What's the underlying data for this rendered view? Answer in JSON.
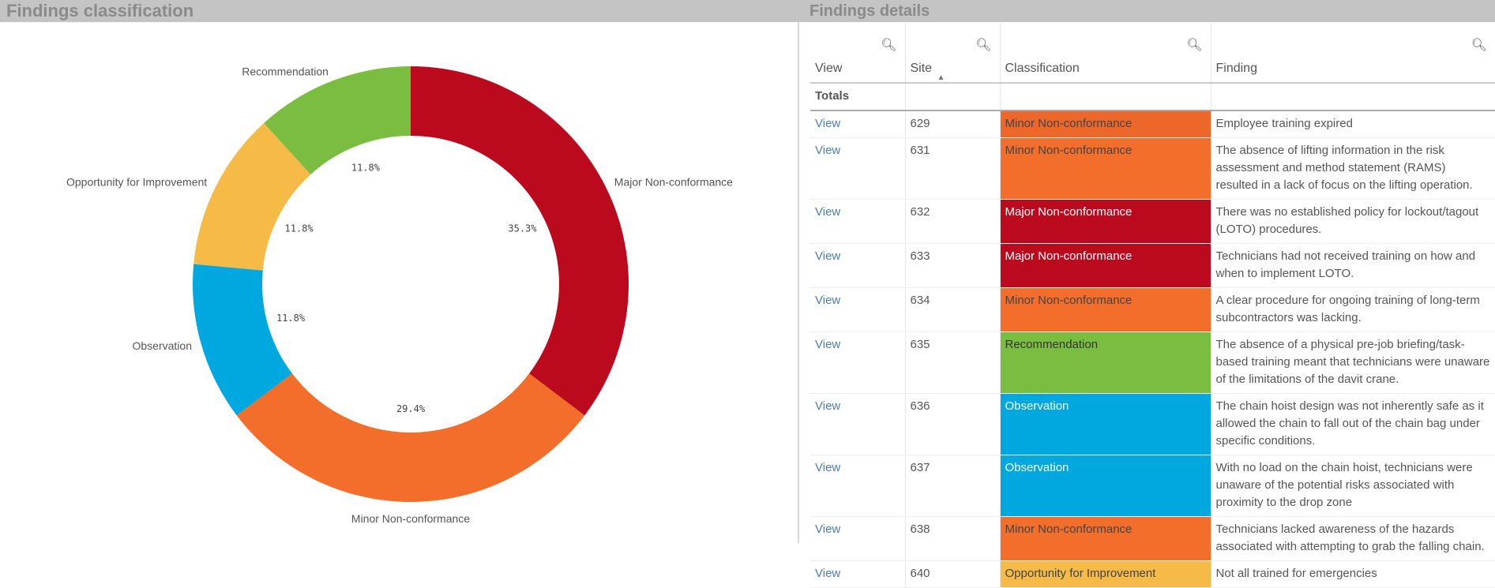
{
  "panels": {
    "left_title": "Findings classification",
    "right_title": "Findings details"
  },
  "chart_data": {
    "type": "pie",
    "donut": true,
    "title": "Findings classification",
    "categories": [
      "Major Non-conformance",
      "Minor Non-conformance",
      "Observation",
      "Opportunity for Improvement",
      "Recommendation"
    ],
    "values": [
      6,
      5,
      2,
      2,
      2
    ],
    "labels": [
      "35.3%",
      "29.4%",
      "11.8%",
      "11.8%",
      "11.8%"
    ],
    "colors": [
      "#bb0a1e",
      "#f26e2a",
      "#00a8e0",
      "#f5bb46",
      "#7abd41"
    ]
  },
  "table": {
    "headers": [
      "View",
      "Site",
      "Classification",
      "Finding"
    ],
    "totals_label": "Totals",
    "rows": [
      {
        "view": "View",
        "site": "629",
        "classification": "Minor Non-conformance",
        "color": "#ec6729",
        "text_color": "#444",
        "finding": "Employee training expired"
      },
      {
        "view": "View",
        "site": "631",
        "classification": "Minor Non-conformance",
        "color": "#f26e2a",
        "text_color": "#444",
        "finding": "The absence of lifting information in the risk assessment and method statement (RAMS) resulted in a lack of focus on the lifting operation."
      },
      {
        "view": "View",
        "site": "632",
        "classification": "Major Non-conformance",
        "color": "#bb0a1e",
        "text_color": "#fff",
        "finding": "There was no established policy for lockout/tagout (LOTO) procedures."
      },
      {
        "view": "View",
        "site": "633",
        "classification": "Major Non-conformance",
        "color": "#bb0a1e",
        "text_color": "#fff",
        "finding": "Technicians had not received training on how and when to implement LOTO."
      },
      {
        "view": "View",
        "site": "634",
        "classification": "Minor Non-conformance",
        "color": "#f26e2a",
        "text_color": "#444",
        "finding": "A clear procedure for ongoing training of long-term subcontractors was lacking."
      },
      {
        "view": "View",
        "site": "635",
        "classification": "Recommendation",
        "color": "#7abd41",
        "text_color": "#333",
        "finding": "The absence of a physical pre-job briefing/task-based training meant that technicians were unaware of the limitations of the davit crane."
      },
      {
        "view": "View",
        "site": "636",
        "classification": "Observation",
        "color": "#00a8e0",
        "text_color": "#fff",
        "finding": "The chain hoist design was not inherently safe as it allowed the chain to fall out of the chain bag under specific conditions."
      },
      {
        "view": "View",
        "site": "637",
        "classification": "Observation",
        "color": "#00a8e0",
        "text_color": "#fff",
        "finding": "With no load on the chain hoist, technicians were unaware of the potential risks associated with proximity to the drop zone"
      },
      {
        "view": "View",
        "site": "638",
        "classification": "Minor Non-conformance",
        "color": "#f26e2a",
        "text_color": "#444",
        "finding": "Technicians lacked awareness of the hazards associated with attempting to grab the falling chain."
      },
      {
        "view": "View",
        "site": "640",
        "classification": "Opportunity for Improvement",
        "color": "#f5bb46",
        "text_color": "#444",
        "finding": "Not all trained for emergencies"
      }
    ]
  }
}
